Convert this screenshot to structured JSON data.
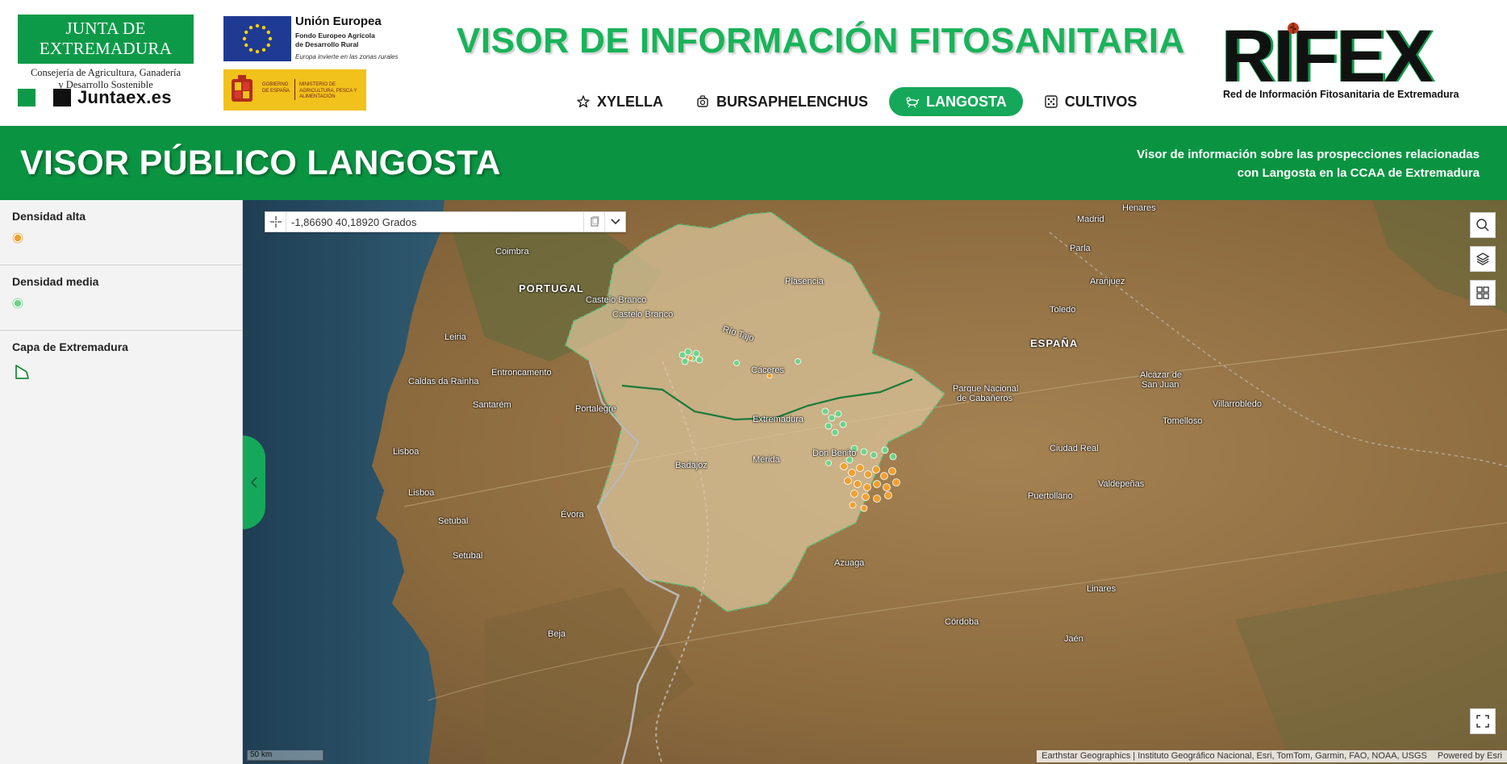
{
  "header": {
    "junta_title": "JUNTA DE EXTREMADURA",
    "junta_sub_1": "Consejería de Agricultura, Ganadería",
    "junta_sub_2": "y Desarrollo Sostenible",
    "juntaex": "Juntaex.es",
    "eu_title": "Unión Europea",
    "eu_fund_1": "Fondo Europeo Agrícola",
    "eu_fund_2": "de Desarrollo Rural",
    "eu_tagline": "Europa invierte en las zonas rurales",
    "gob_1": "GOBIERNO DE ESPAÑA",
    "gob_2": "MINISTERIO DE AGRICULTURA, PESCA Y ALIMENTACIÓN",
    "main_title": "VISOR DE INFORMACIÓN FITOSANITARIA",
    "rifex_word": "RIFEX",
    "rifex_sub": "Red de Información Fitosanitaria de Extremadura"
  },
  "nav": {
    "items": [
      {
        "label": "XYLELLA",
        "icon": "star-icon",
        "active": false
      },
      {
        "label": "BURSAPHELENCHUS",
        "icon": "tree-icon",
        "active": false
      },
      {
        "label": "LANGOSTA",
        "icon": "locust-icon",
        "active": true
      },
      {
        "label": "CULTIVOS",
        "icon": "grid-dots-icon",
        "active": false
      }
    ]
  },
  "banner": {
    "title": "VISOR PÚBLICO LANGOSTA",
    "desc_1": "Visor de información sobre las prospecciones relacionadas",
    "desc_2": "con Langosta en la CCAA de Extremadura"
  },
  "legend": [
    {
      "title": "Densidad alta",
      "color": "#f0a030"
    },
    {
      "title": "Densidad media",
      "color": "#6ed38a"
    },
    {
      "title": "Capa de Extremadura",
      "color": "#1e8a3c"
    }
  ],
  "map": {
    "coordinates": "-1,86690 40,18920 Grados",
    "scale": "50 km",
    "attribution": "Earthstar Geographics | Instituto Geográfico Nacional, Esri, TomTom, Garmin, FAO, NOAA, USGS",
    "powered_by": "Powered by Esri",
    "labels": {
      "madrid": "Madrid",
      "henares": "Henares",
      "parla": "Parla",
      "aranjuez": "Aranjuez",
      "toledo": "Toledo",
      "espana": "ESPAÑA",
      "portugal": "PORTUGAL",
      "coimbra": "Coimbra",
      "castelo1": "Castelo Branco",
      "castelo2": "Castelo Branco",
      "plasencia": "Plasencia",
      "rio_tajo": "Río Tajo",
      "caceres": "Cáceres",
      "leiria": "Leiria",
      "entroncamento": "Entroncamento",
      "caldas": "Caldas da Rainha",
      "santarem": "Santarém",
      "portalegre": "Portalegre",
      "extremadura": "Extremadura",
      "cabaneros_1": "Parque Nacional",
      "cabaneros_2": "de Cabañeros",
      "alcazar_1": "Alcázar de",
      "alcazar_2": "San Juan",
      "villarrobledo": "Villarrobledo",
      "tomelloso": "Tomelloso",
      "lisboa1": "Lisboa",
      "lisboa2": "Lisboa",
      "badajoz": "Badajoz",
      "merida": "Mérida",
      "don_benito": "Don Benito",
      "ciudad_real": "Ciudad Real",
      "puertollano": "Puertollano",
      "valdepenas": "Valdepeñas",
      "setubal1": "Setubal",
      "setubal2": "Setubal",
      "evora": "Évora",
      "azuaga": "Azuaga",
      "linares": "Linares",
      "cordoba": "Córdoba",
      "beja": "Beja",
      "jaen": "Jaén"
    }
  }
}
